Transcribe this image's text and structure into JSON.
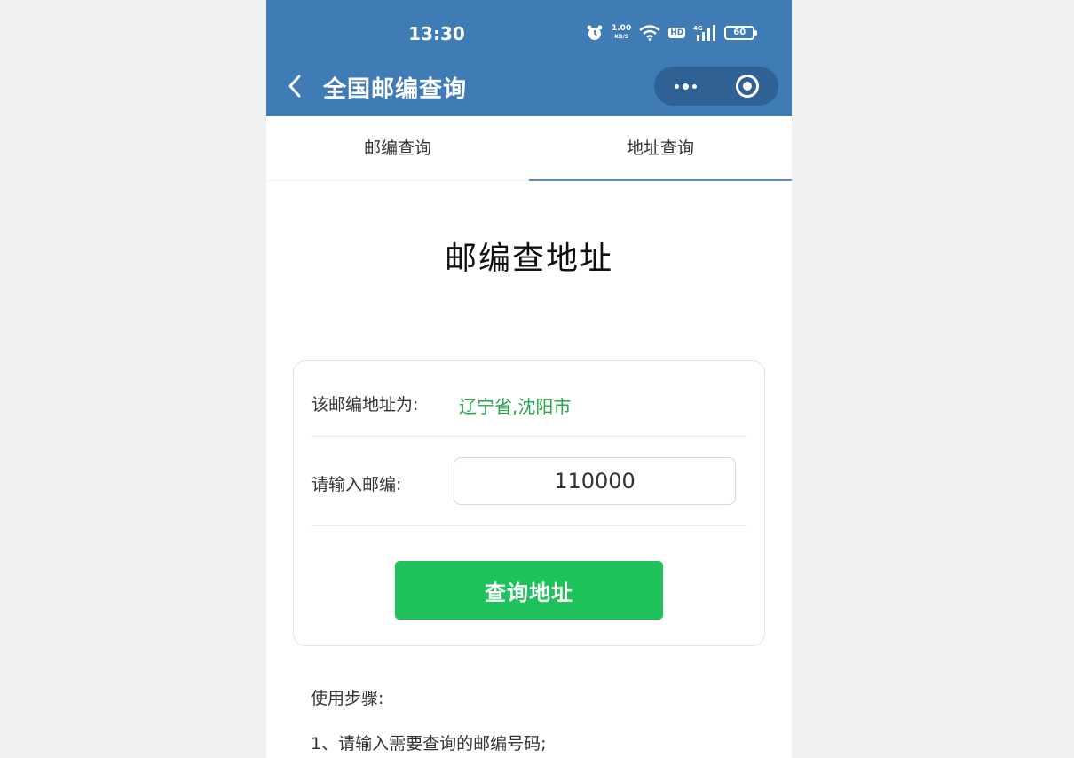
{
  "status_bar": {
    "time": "13:30",
    "speed_value": "1.00",
    "speed_unit": "KB/S",
    "hd_badge": "HD",
    "network": "4G",
    "battery": "60"
  },
  "nav": {
    "title": "全国邮编查询"
  },
  "tabs": [
    {
      "label": "邮编查询",
      "active": false
    },
    {
      "label": "地址查询",
      "active": true
    }
  ],
  "main": {
    "heading": "邮编查地址",
    "result_label": "该邮编地址为:",
    "result_value": "辽宁省,沈阳市",
    "input_label": "请输入邮编:",
    "input_value": "110000",
    "button_label": "查询地址"
  },
  "instructions": {
    "title": "使用步骤:",
    "steps": [
      "1、请输入需要查询的邮编号码;"
    ]
  },
  "colors": {
    "header_bg": "#3f7cb6",
    "accent_green": "#1fc15b",
    "result_green": "#23a84a",
    "tab_underline": "#5b8ec4"
  }
}
